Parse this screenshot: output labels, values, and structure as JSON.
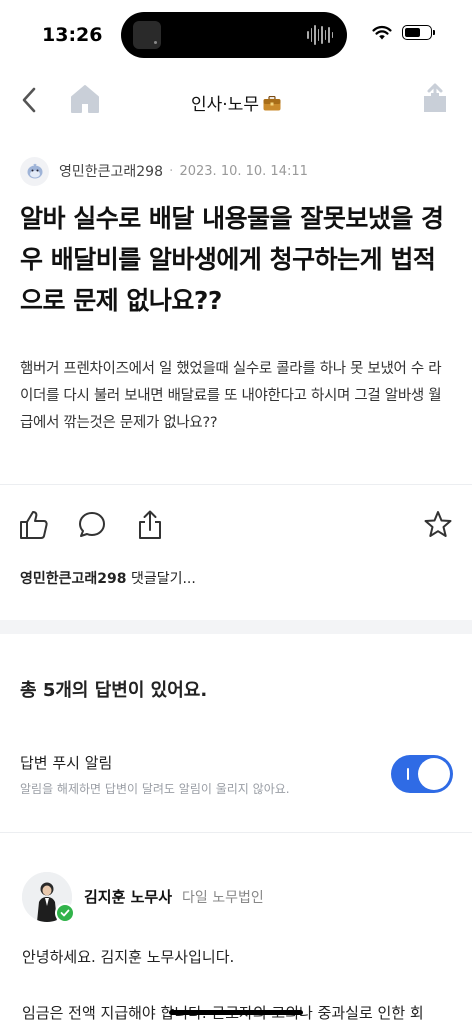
{
  "status": {
    "time": "13:26"
  },
  "nav": {
    "title": "인사·노무",
    "icons": [
      "back-chevron-icon",
      "home-icon",
      "briefcase-icon",
      "share-icon"
    ]
  },
  "post": {
    "author": "영민한큰고래298",
    "separator": "·",
    "date": "2023. 10. 10. 14:11",
    "title": "알바 실수로 배달 내용물을 잘못보냈을 경우 배달비를 알바생에게 청구하는게 법적으로 문제 없나요??",
    "body": "햄버거 프렌차이즈에서 일 했었을때 실수로 콜라를 하나 못 보냈어 수 라이더를 다시 불러 보내면 배달료를 또 내야한다고 하시며 그걸 알바생 월급에서 깎는것은 문제가 없나요??"
  },
  "actions": {
    "icons": [
      "like-icon",
      "comment-icon",
      "share-icon",
      "star-icon"
    ],
    "comment_user": "영민한큰고래298",
    "comment_placeholder": " 댓글달기..."
  },
  "answers": {
    "count_text": "총 5개의 답변이 있어요.",
    "push_label": "답변 푸시 알림",
    "push_desc": "알림을 해제하면 답변이 달려도 알림이 울리지 않아요.",
    "push_enabled": true,
    "accent_color": "#2f6be5"
  },
  "answer": {
    "name": "김지훈 노무사",
    "org": "다일 노무법인",
    "verified_color": "#31b34a",
    "greeting": "안녕하세요. 김지훈 노무사입니다.",
    "body_preview": "임금은 전액 지급해야 합니다. 근로자의 고의나 중과실로 인한 회"
  }
}
